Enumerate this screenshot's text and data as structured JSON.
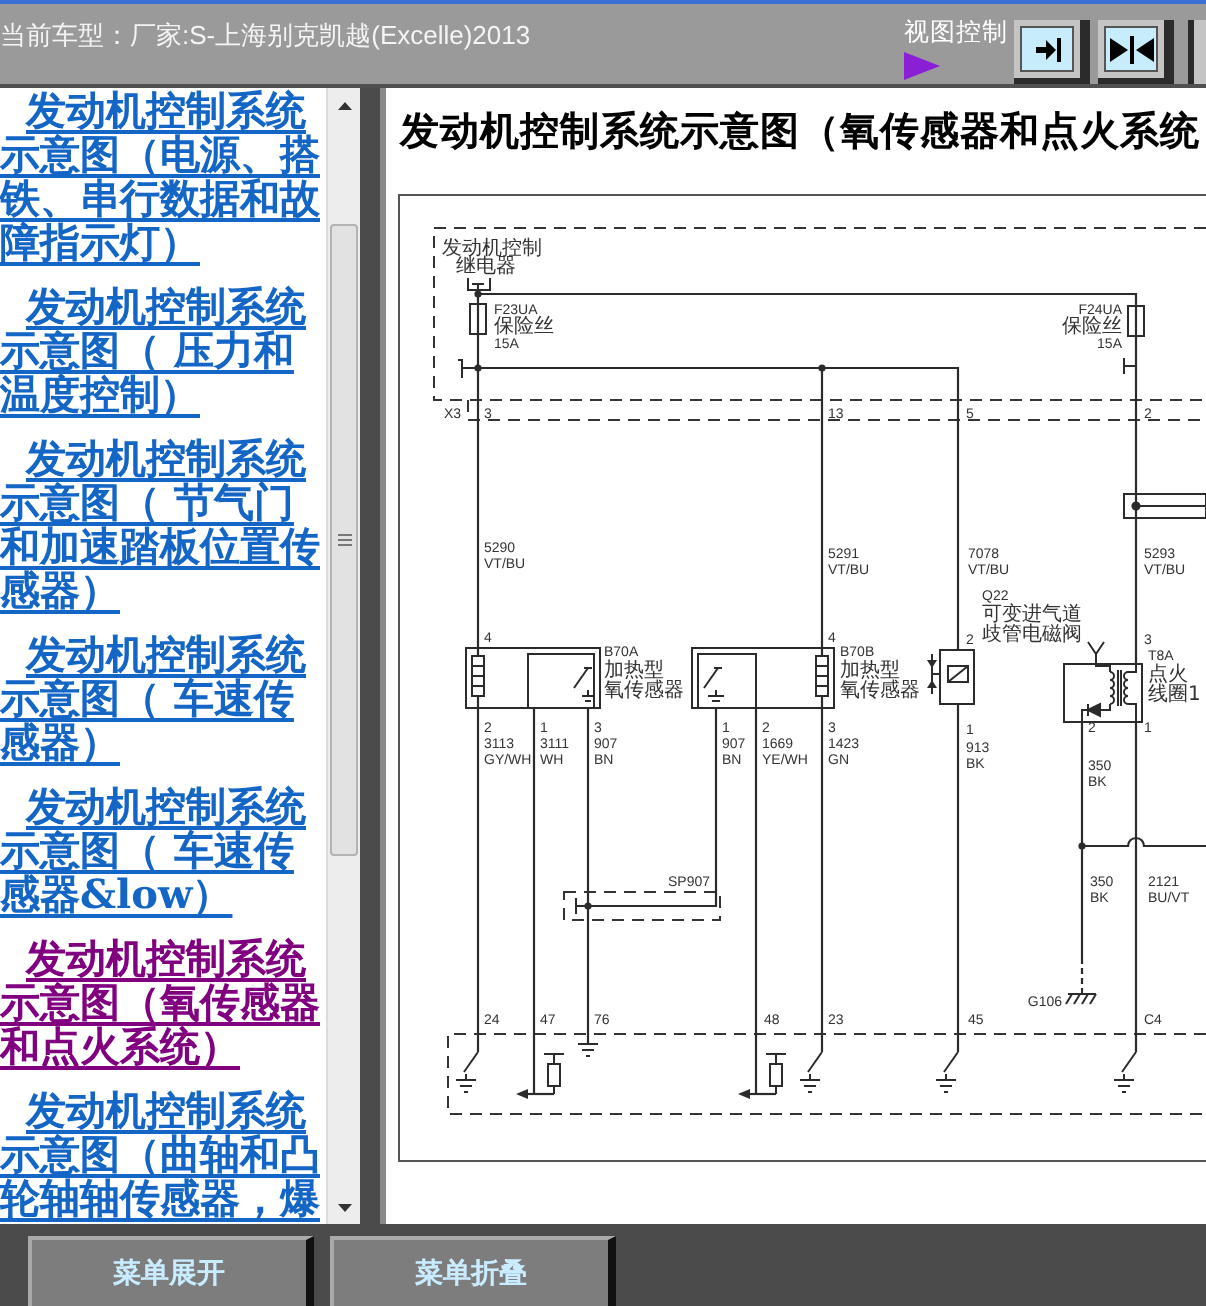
{
  "header": {
    "vehicle": "当前车型：厂家:S-上海别克凯越(Excelle)2013",
    "view_control": "视图控制"
  },
  "sidebar": {
    "items": [
      {
        "text": "发动机控制系统示意图（电源、搭铁、串行数据和故障指示灯）",
        "visited": false
      },
      {
        "text": "发动机控制系统示意图（ 压力和温度控制）",
        "visited": false
      },
      {
        "text": "发动机控制系统示意图（ 节气门和加速踏板位置传感器）",
        "visited": false
      },
      {
        "text": "发动机控制系统示意图（ 车速传感器）",
        "visited": false
      },
      {
        "text": "发动机控制系统示意图（ 车速传感器&low）",
        "visited": false
      },
      {
        "text": "发动机控制系统示意图（氧传感器和点火系统）",
        "visited": true
      },
      {
        "text": "发动机控制系统示意图（曲轴和凸轮轴轴传感器，爆",
        "visited": false
      }
    ]
  },
  "content": {
    "title": "发动机控制系统示意图（氧传感器和点火系统",
    "diagram": {
      "relay_label": [
        "发动机控制",
        "继电器"
      ],
      "fuses": [
        {
          "name": "F23UA",
          "type": "保险丝",
          "rating": "15A"
        },
        {
          "name": "F24UA",
          "type": "保险丝",
          "rating": "15A"
        }
      ],
      "connector": {
        "name": "X3",
        "pins": [
          "3",
          "13",
          "5",
          "2"
        ]
      },
      "supply_wires": [
        {
          "circuit": "5290",
          "color_code": "VT/BU"
        },
        {
          "circuit": "5291",
          "color_code": "VT/BU"
        },
        {
          "circuit": "7078",
          "color_code": "VT/BU"
        },
        {
          "circuit": "5293",
          "color_code": "VT/BU"
        }
      ],
      "components": [
        {
          "name": "B70A",
          "description": [
            "加热型",
            "氧传感器"
          ],
          "pin": "4"
        },
        {
          "name": "B70B",
          "description": [
            "加热型",
            "氧传感器"
          ],
          "pin": "4"
        },
        {
          "name": "Q22",
          "description": [
            "可变进气道",
            "歧管电磁阀"
          ],
          "pin": "2"
        },
        {
          "name": "T8A",
          "description": [
            "点火",
            "线圈1"
          ],
          "pin": "3"
        }
      ],
      "component_wires": [
        {
          "pin": "2",
          "circuit": "3113",
          "color_code": "GY/WH"
        },
        {
          "pin": "1",
          "circuit": "3111",
          "color_code": "WH"
        },
        {
          "pin": "3",
          "circuit": "907",
          "color_code": "BN"
        },
        {
          "pin": "1",
          "circuit": "907",
          "color_code": "BN"
        },
        {
          "pin": "2",
          "circuit": "1669",
          "color_code": "YE/WH"
        },
        {
          "pin": "3",
          "circuit": "1423",
          "color_code": "GN"
        },
        {
          "pin": "1",
          "circuit": "913",
          "color_code": "BK"
        },
        {
          "pin": "2",
          "circuit": "350",
          "color_code": "BK"
        },
        {
          "pin": "1"
        }
      ],
      "ground_wires": [
        {
          "circuit": "350",
          "color_code": "BK"
        },
        {
          "circuit": "2121",
          "color_code": "BU/VT"
        }
      ],
      "splice": "SP907",
      "ground": "G106",
      "module_pins": [
        "24",
        "47",
        "76",
        "48",
        "23",
        "45",
        "C4"
      ]
    }
  },
  "footer_buttons": [
    "菜单展开",
    "菜单折叠"
  ]
}
